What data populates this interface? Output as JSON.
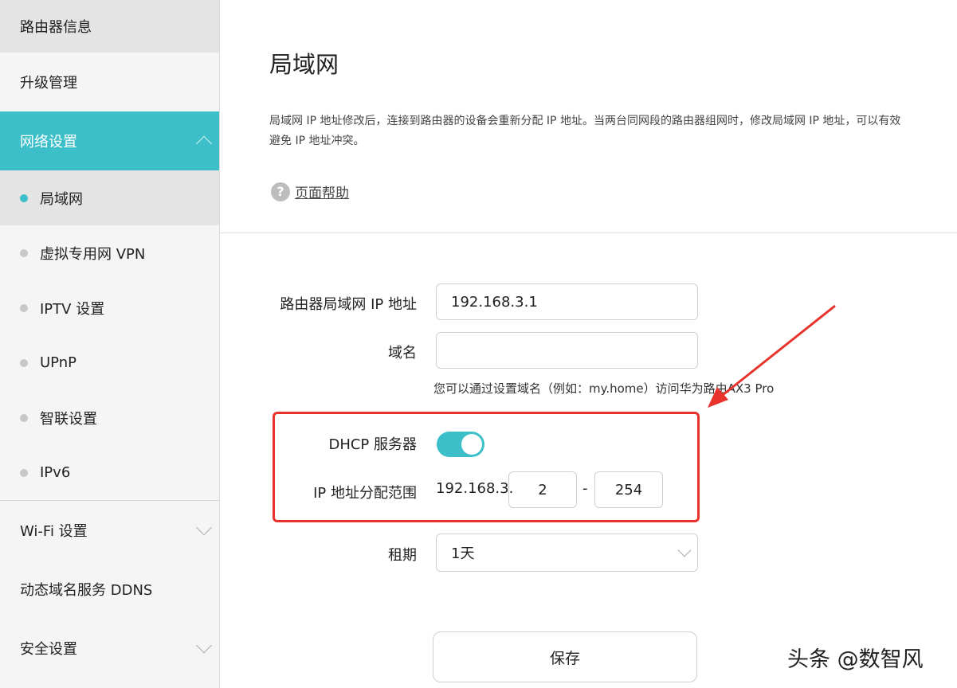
{
  "sidebar": {
    "top_item": "路由器信息",
    "upgrade": "升级管理",
    "network": "网络设置",
    "network_sub": [
      {
        "label": "局域网"
      },
      {
        "label": "虚拟专用网 VPN"
      },
      {
        "label": "IPTV 设置"
      },
      {
        "label": "UPnP"
      },
      {
        "label": "智联设置"
      },
      {
        "label": "IPv6"
      }
    ],
    "wifi": "Wi-Fi 设置",
    "ddns": "动态域名服务 DDNS",
    "security": "安全设置"
  },
  "main": {
    "title": "局域网",
    "description": "局域网 IP 地址修改后，连接到路由器的设备会重新分配 IP 地址。当两台同网段的路由器组网时，修改局域网 IP 地址，可以有效避免 IP 地址冲突。",
    "help_icon": "question-circle-icon",
    "help_text": "页面帮助",
    "form": {
      "lan_ip_label": "路由器局域网 IP 地址",
      "lan_ip_value": "192.168.3.1",
      "domain_label": "域名",
      "domain_value": "",
      "domain_hint": "您可以通过设置域名（例如：my.home）访问华为路由AX3 Pro",
      "dhcp_label": "DHCP 服务器",
      "dhcp_enabled": true,
      "range_label": "IP 地址分配范围",
      "range_prefix": "192.168.3.",
      "range_start": "2",
      "range_dash": "-",
      "range_end": "254",
      "lease_label": "租期",
      "lease_value": "1天"
    },
    "save_label": "保存"
  },
  "watermark": "头条 @数智风",
  "colors": {
    "accent": "#3cbfc8",
    "annotation": "#e8322c"
  }
}
